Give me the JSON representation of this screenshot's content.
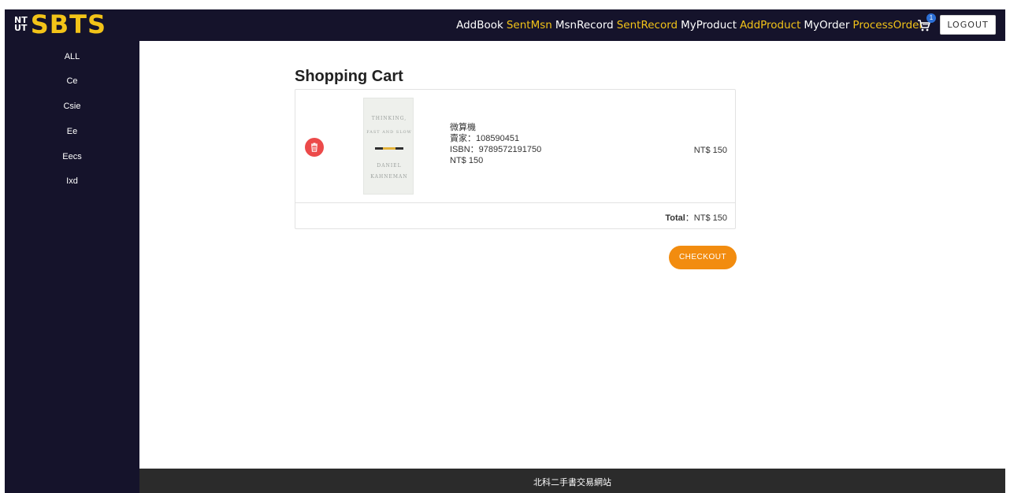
{
  "header": {
    "logo_mark_top": "NT",
    "logo_mark_bottom": "UT",
    "logo_text": "SBTS",
    "nav": [
      {
        "label": "AddBook",
        "color": "#ffffff"
      },
      {
        "label": "SentMsn",
        "color": "#f2c318"
      },
      {
        "label": "MsnRecord",
        "color": "#ffffff"
      },
      {
        "label": "SentRecord",
        "color": "#f2c318"
      },
      {
        "label": "MyProduct",
        "color": "#ffffff"
      },
      {
        "label": "AddProduct",
        "color": "#f2c318"
      },
      {
        "label": "MyOrder",
        "color": "#ffffff"
      },
      {
        "label": "ProcessOrder",
        "color": "#f2c318"
      }
    ],
    "cart_icon": "shopping-cart-icon",
    "cart_count": "1",
    "logout_label": "LOGOUT"
  },
  "sidebar": {
    "items": [
      {
        "label": "ALL"
      },
      {
        "label": "Ce"
      },
      {
        "label": "Csie"
      },
      {
        "label": "Ee"
      },
      {
        "label": "Eecs"
      },
      {
        "label": "Ixd"
      }
    ]
  },
  "main": {
    "title": "Shopping Cart",
    "items": [
      {
        "delete_icon": "trash-icon",
        "cover": {
          "line1": "THINKING,",
          "line2": "FAST AND SLOW",
          "line3": "DANIEL",
          "line4": "KAHNEMAN"
        },
        "name": "微算機",
        "seller": "賣家：108590451",
        "isbn": "ISBN：9789572191750",
        "price": "NT$ 150",
        "subtotal": "NT$ 150"
      }
    ],
    "total_label": "Total",
    "total_value": "：NT$ 150",
    "checkout_label": "CHECKOUT"
  },
  "footer": {
    "text": "北科二手書交易網站"
  },
  "colors": {
    "topbar_bg": "#15132b",
    "accent_yellow": "#f2c318",
    "checkout_orange": "#f28c0f",
    "delete_red": "#ec4a4a",
    "badge_blue": "#2c6fd6",
    "footer_bg": "#2b2b2b"
  }
}
